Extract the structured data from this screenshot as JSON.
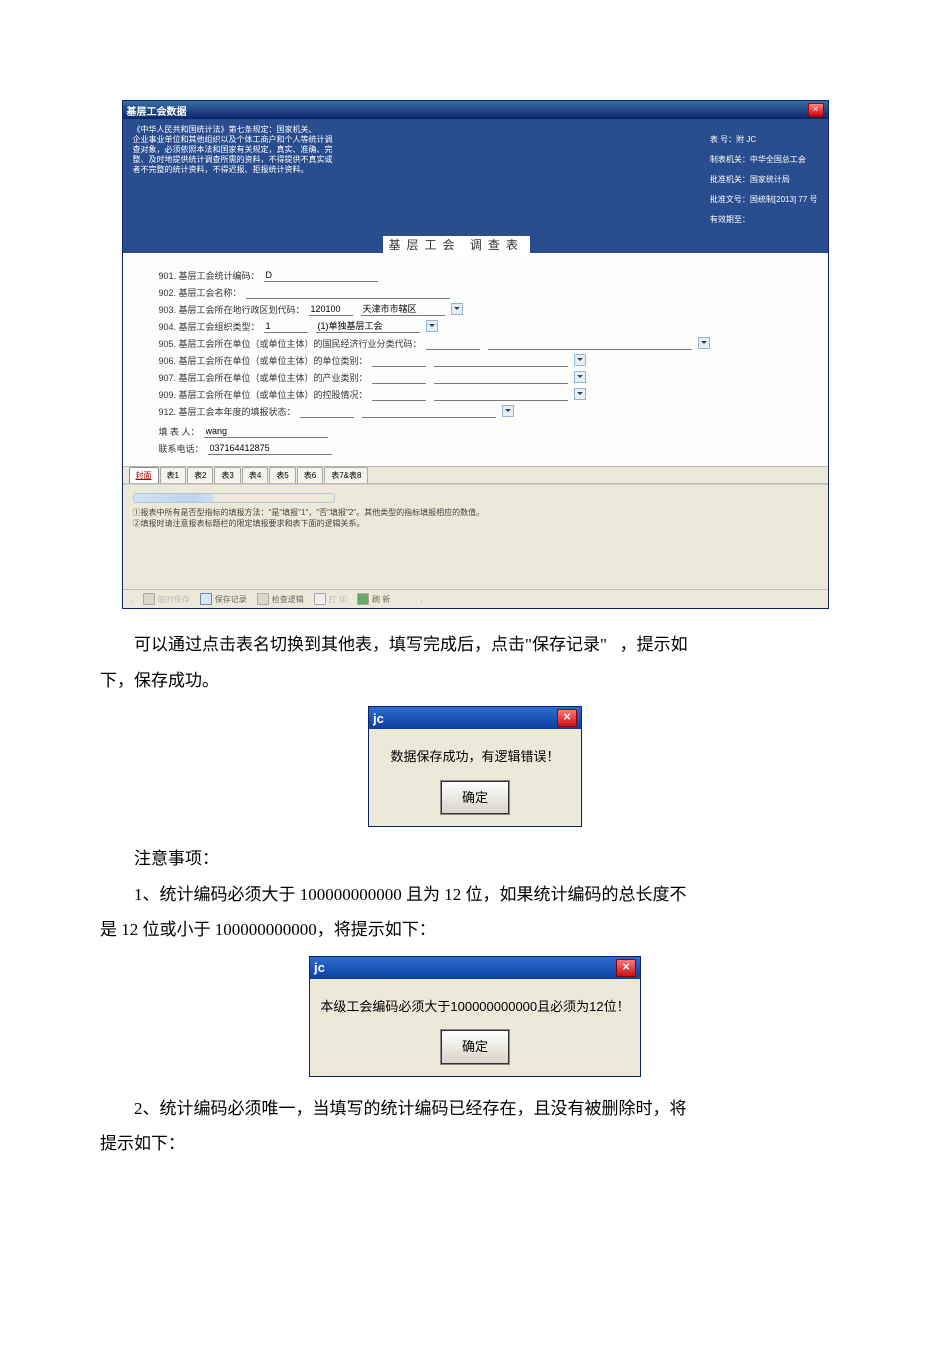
{
  "window": {
    "title": "基层工会数据",
    "law_text": "《中华人民共和国统计法》第七条规定：国家机关、\n企业事业单位和其他组织以及个体工商户和个人等统计调\n查对象，必须依照本法和国家有关规定，真实、准确、完\n整、及时地提供统计调查所需的资料，不得提供不真实或\n者不完整的统计资料，不得迟报、拒报统计资料。",
    "meta": {
      "l1": "表     号：附 JC",
      "l2": "制表机关：中华全国总工会",
      "l3": "批准机关：国家统计局",
      "l4": "批准文号：国统制[2013] 77 号",
      "l5": "有效期至："
    },
    "center_title": "   基层工会  调查表"
  },
  "fields": {
    "f901_label": "901. 基层工会统计编码：",
    "f901_value": "D",
    "f902_label": "902. 基层工会名称：",
    "f903_label": "903. 基层工会所在地行政区划代码：",
    "f903_code": "120100",
    "f903_name": "天津市市辖区",
    "f904_label": "904. 基层工会组织类型：",
    "f904_code": "1",
    "f904_text": "(1)单独基层工会",
    "f905_label": "905. 基层工会所在单位（或单位主体）的国民经济行业分类代码：",
    "f906_label": "906. 基层工会所在单位（或单位主体）的单位类别：",
    "f907_label": "907. 基层工会所在单位（或单位主体）的产业类别：",
    "f909_label": "909. 基层工会所在单位（或单位主体）的控股情况：",
    "f912_label": "912. 基层工会本年度的填报状态：",
    "filler_label": "填 表 人：",
    "filler_value": "wang",
    "phone_label": "联系电话：",
    "phone_value": "037164412875"
  },
  "tabs": [
    "封面",
    "表1",
    "表2",
    "表3",
    "表4",
    "表5",
    "表6",
    "表7&表8"
  ],
  "notes": {
    "n1": "①报表中所有是否型指标的填报方法：\"是\"填报\"1\"，\"否\"填报\"2\"。其他类型的指标填报相应的数值。",
    "n2": "②填报时请注意报表标题栏的限定填报要求和表下面的逻辑关系。"
  },
  "status": {
    "tempsave": "临时保存",
    "save": "保存记录",
    "check": "检查逻辑",
    "print": "打 印",
    "refresh": "刷 新"
  },
  "body": {
    "p1a": "可以通过点击表名切换到其他表，填写完成后，点击\"保存记录\"",
    "p1b": "，提示如",
    "p2": "下，保存成功。",
    "notice_heading": "注意事项：",
    "note1a": "1、统计编码必须大于 100000000000 且为 12 位，如果统计编码的总长度不",
    "note1b": "是 12 位或小于 100000000000，将提示如下：",
    "note2a": "2、统计编码必须唯一，当填写的统计编码已经存在，且没有被删除时，将",
    "note2b": "提示如下："
  },
  "dialog1": {
    "title": "jc",
    "msg": "数据保存成功，有逻辑错误！",
    "ok": "确定"
  },
  "dialog2": {
    "title": "jc",
    "msg": "本级工会编码必须大于100000000000且必须为12位！",
    "ok": "确定"
  }
}
